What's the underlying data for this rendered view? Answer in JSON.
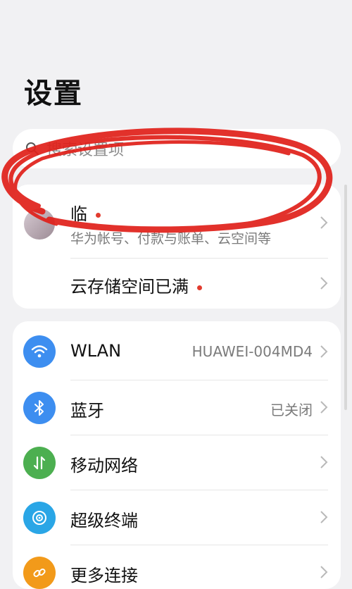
{
  "header": {
    "title": "设置"
  },
  "search": {
    "placeholder": "搜索设置项"
  },
  "account": {
    "name": "临",
    "subtitle": "华为帐号、付款与账单、云空间等",
    "storage_label": "云存储空间已满"
  },
  "network": {
    "items": [
      {
        "label": "WLAN",
        "value": "HUAWEI-004MD4",
        "icon": "wifi-icon",
        "color": "#3d8ef0"
      },
      {
        "label": "蓝牙",
        "value": "已关闭",
        "icon": "bluetooth-icon",
        "color": "#3d8ef0"
      },
      {
        "label": "移动网络",
        "value": "",
        "icon": "mobile-network-icon",
        "color": "#4caf50"
      },
      {
        "label": "超级终端",
        "value": "",
        "icon": "super-device-icon",
        "color": "#2aa6e6"
      },
      {
        "label": "更多连接",
        "value": "",
        "icon": "more-connections-icon",
        "color": "#f29a1a"
      }
    ]
  },
  "colors": {
    "notification_dot": "#e23b2e",
    "annotation": "#e0201a"
  }
}
